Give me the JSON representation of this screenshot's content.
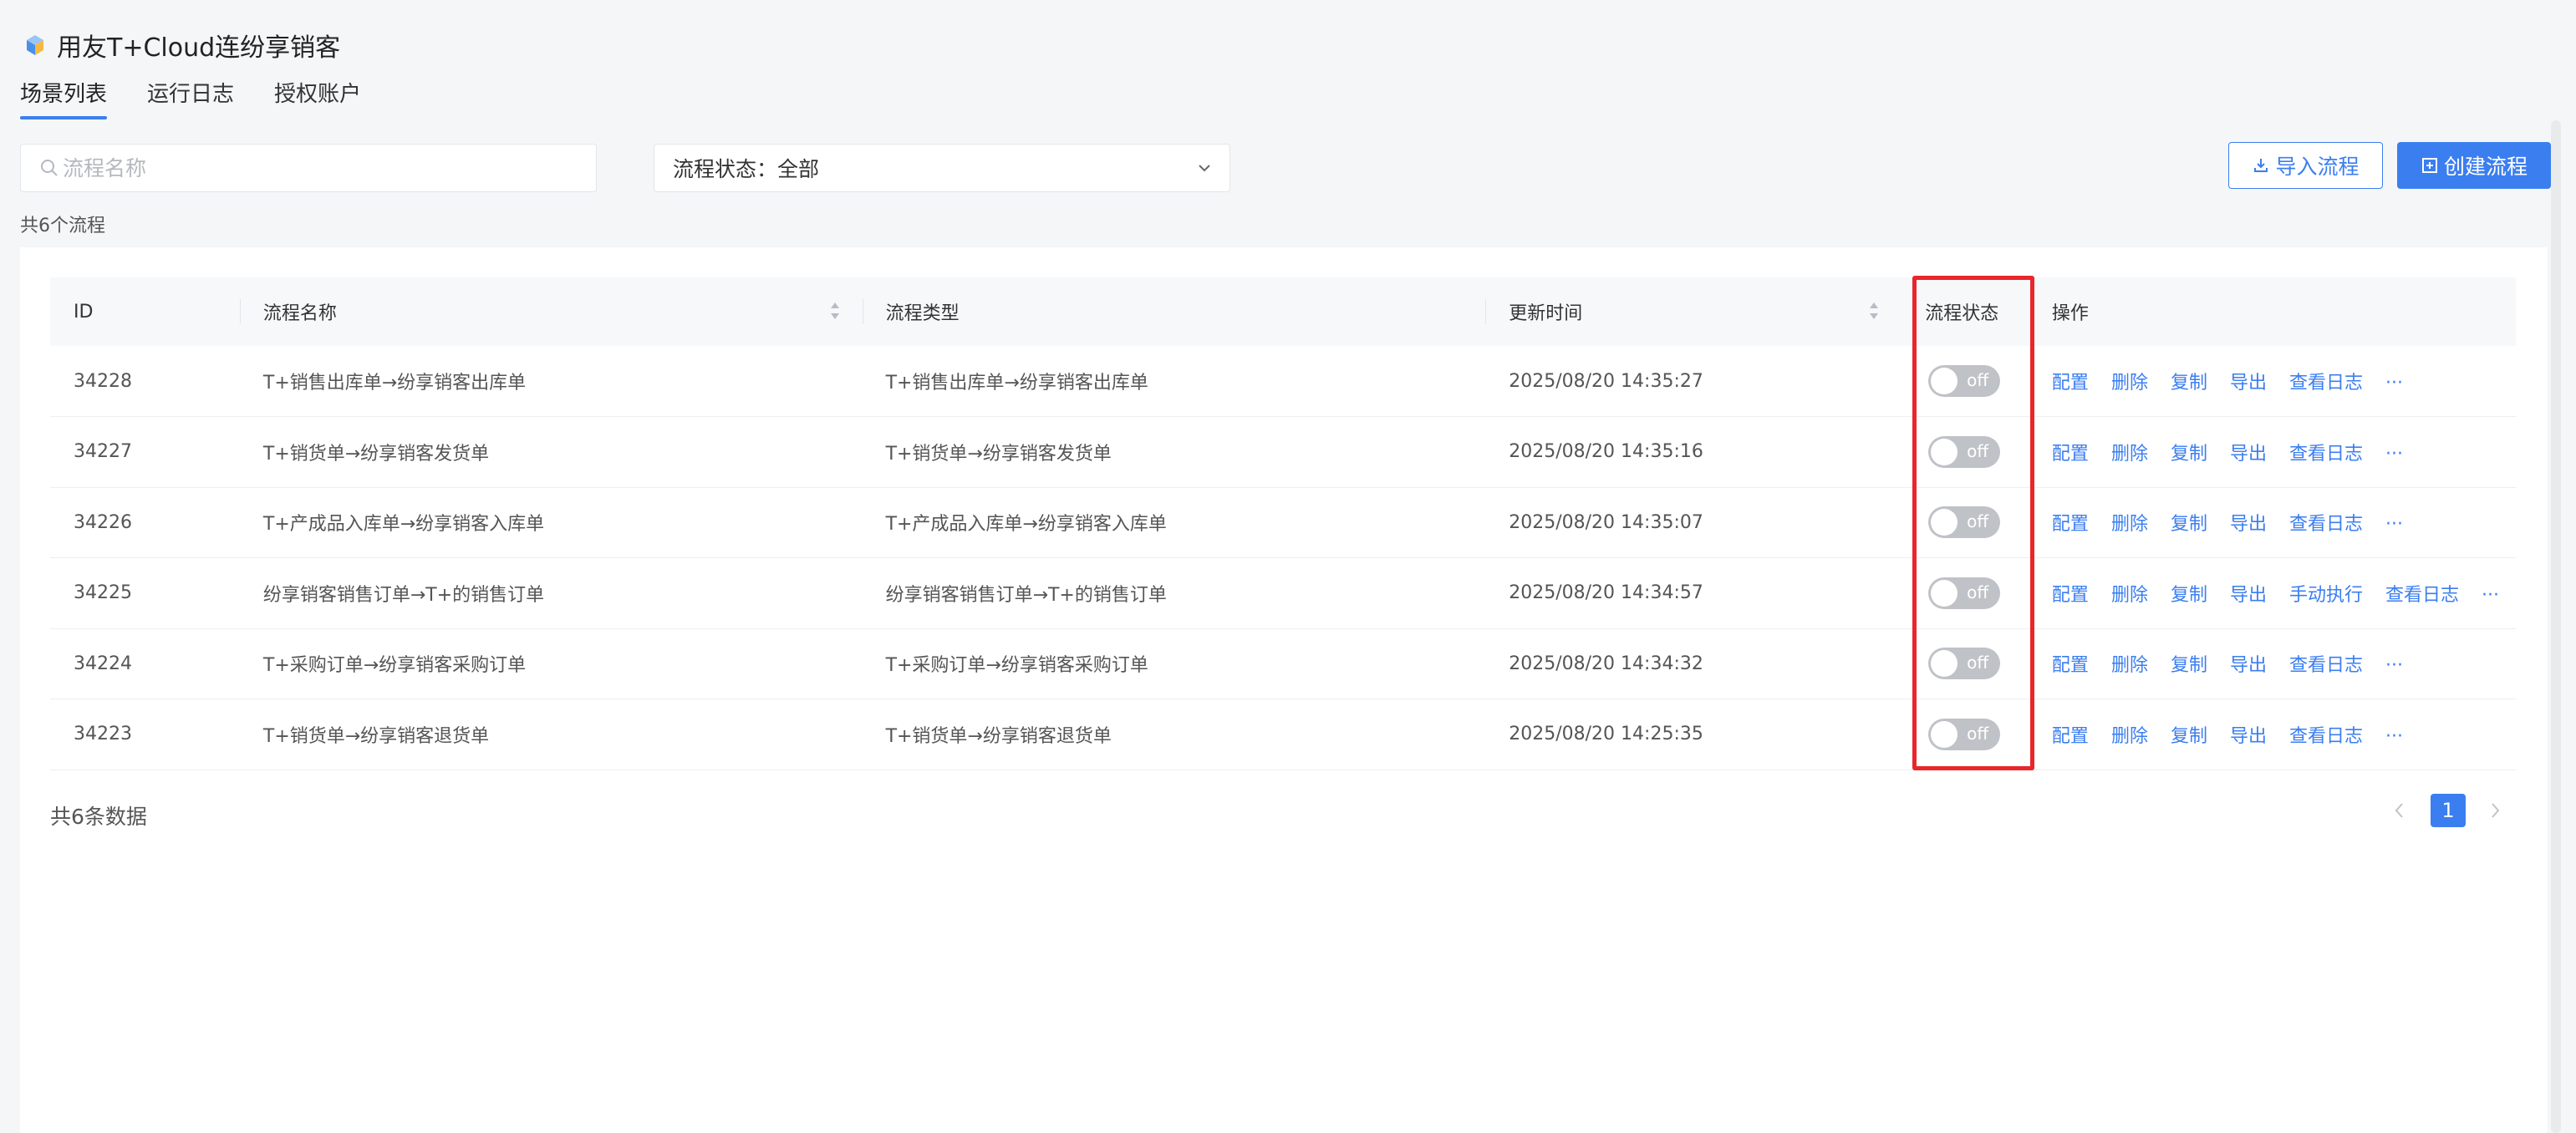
{
  "app": {
    "title": "用友T+Cloud连纷享销客",
    "logo_icon": "app-logo-icon"
  },
  "tabs": [
    {
      "label": "场景列表",
      "active": true
    },
    {
      "label": "运行日志",
      "active": false
    },
    {
      "label": "授权账户",
      "active": false
    }
  ],
  "search": {
    "placeholder": "流程名称",
    "value": ""
  },
  "status_filter": {
    "label": "流程状态：全部"
  },
  "buttons": {
    "import": "导入流程",
    "create": "创建流程"
  },
  "summary": {
    "total_flows": "共6个流程",
    "total_data": "共6条数据"
  },
  "table": {
    "headers": {
      "id": "ID",
      "name": "流程名称",
      "type": "流程类型",
      "time": "更新时间",
      "status": "流程状态",
      "actions": "操作"
    },
    "rows": [
      {
        "id": "34228",
        "name": "T+销售出库单→纷享销客出库单",
        "type": "T+销售出库单→纷享销客出库单",
        "time": "2025/08/20 14:35:27",
        "status": "off",
        "actions": [
          "配置",
          "删除",
          "复制",
          "导出",
          "查看日志",
          "···"
        ]
      },
      {
        "id": "34227",
        "name": "T+销货单→纷享销客发货单",
        "type": "T+销货单→纷享销客发货单",
        "time": "2025/08/20 14:35:16",
        "status": "off",
        "actions": [
          "配置",
          "删除",
          "复制",
          "导出",
          "查看日志",
          "···"
        ]
      },
      {
        "id": "34226",
        "name": "T+产成品入库单→纷享销客入库单",
        "type": "T+产成品入库单→纷享销客入库单",
        "time": "2025/08/20 14:35:07",
        "status": "off",
        "actions": [
          "配置",
          "删除",
          "复制",
          "导出",
          "查看日志",
          "···"
        ]
      },
      {
        "id": "34225",
        "name": "纷享销客销售订单→T+的销售订单",
        "type": "纷享销客销售订单→T+的销售订单",
        "time": "2025/08/20 14:34:57",
        "status": "off",
        "actions": [
          "配置",
          "删除",
          "复制",
          "导出",
          "手动执行",
          "查看日志",
          "···"
        ]
      },
      {
        "id": "34224",
        "name": "T+采购订单→纷享销客采购订单",
        "type": "T+采购订单→纷享销客采购订单",
        "time": "2025/08/20 14:34:32",
        "status": "off",
        "actions": [
          "配置",
          "删除",
          "复制",
          "导出",
          "查看日志",
          "···"
        ]
      },
      {
        "id": "34223",
        "name": "T+销货单→纷享销客退货单",
        "type": "T+销货单→纷享销客退货单",
        "time": "2025/08/20 14:25:35",
        "status": "off",
        "actions": [
          "配置",
          "删除",
          "复制",
          "导出",
          "查看日志",
          "···"
        ]
      }
    ]
  },
  "pagination": {
    "current_page": "1"
  },
  "colors": {
    "accent": "#3b7ef0",
    "highlight": "#e8262b",
    "toggle_off": "#bfc2c7"
  }
}
